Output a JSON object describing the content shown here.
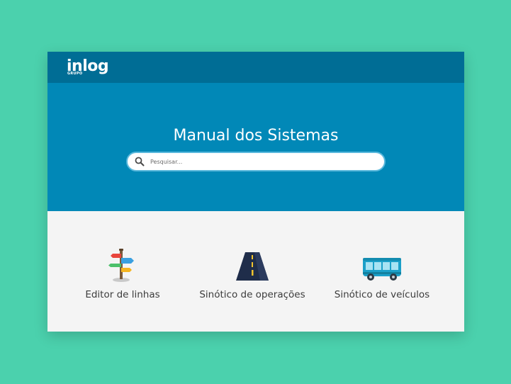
{
  "header": {
    "logo_main": "inlog",
    "logo_sub": "GRUPO"
  },
  "hero": {
    "title": "Manual dos Sistemas"
  },
  "search": {
    "placeholder": "Pesquisar...",
    "icon": "search-icon"
  },
  "colors": {
    "background": "#4bd1ad",
    "topbar": "#006d95",
    "hero": "#0188b7",
    "content": "#f4f4f4"
  },
  "cards": [
    {
      "label": "Editor de linhas",
      "icon": "signpost-icon"
    },
    {
      "label": "Sinótico de operações",
      "icon": "road-icon"
    },
    {
      "label": "Sinótico de veículos",
      "icon": "bus-icon"
    }
  ]
}
